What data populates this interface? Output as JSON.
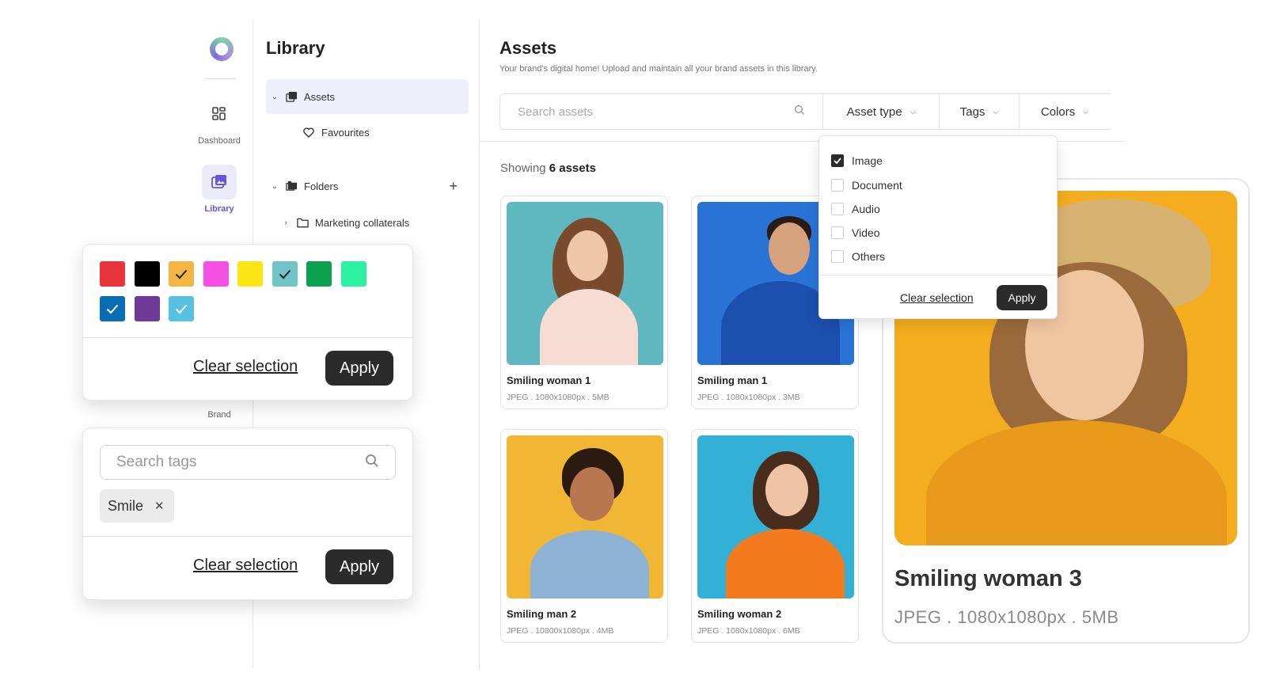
{
  "rail": {
    "items": [
      {
        "label": "Dashboard",
        "icon": "grid-icon"
      },
      {
        "label": "Library",
        "icon": "image-stack-icon",
        "active": true
      },
      {
        "label": "Brand",
        "icon": "brand-icon"
      }
    ]
  },
  "library": {
    "title": "Library",
    "tree": {
      "assets": "Assets",
      "favourites": "Favourites",
      "folders": "Folders",
      "marketing": "Marketing collaterals"
    }
  },
  "assets": {
    "title": "Assets",
    "subtitle": "Your brand's digital home! Upload and maintain all your brand assets in this library.",
    "search_placeholder": "Search assets",
    "filters": {
      "asset_type": "Asset type",
      "tags": "Tags",
      "colors": "Colors"
    },
    "showing_prefix": "Showing",
    "showing_count": "6 assets",
    "cards": [
      {
        "name": "Smiling woman 1",
        "meta": "JPEG . 1080x1080px . 5MB",
        "bg": "#5fb7bf"
      },
      {
        "name": "Smiling man 1",
        "meta": "JPEG . 1080x1080px . 3MB",
        "bg": "#2a73d6"
      },
      {
        "name": "Smiling man 2",
        "meta": "JPEG . 10800x1080px . 4MB",
        "bg": "#f1b633"
      },
      {
        "name": "Smiling woman 2",
        "meta": "JPEG . 1080x1080px . 6MB",
        "bg": "#33b0d6"
      }
    ]
  },
  "preview": {
    "name": "Smiling woman 3",
    "meta": "JPEG . 1080x1080px . 5MB"
  },
  "asset_type_dropdown": {
    "options": [
      {
        "label": "Image",
        "checked": true
      },
      {
        "label": "Document",
        "checked": false
      },
      {
        "label": "Audio",
        "checked": false
      },
      {
        "label": "Video",
        "checked": false
      },
      {
        "label": "Others",
        "checked": false
      }
    ],
    "clear_label": "Clear selection",
    "apply_label": "Apply"
  },
  "colors_panel": {
    "swatches": [
      {
        "color": "#e8343c",
        "checked": false
      },
      {
        "color": "#000000",
        "checked": false
      },
      {
        "color": "#f5b544",
        "checked": true
      },
      {
        "color": "#f54fe3",
        "checked": false
      },
      {
        "color": "#fbe514",
        "checked": false
      },
      {
        "color": "#72c3c7",
        "checked": true
      },
      {
        "color": "#0da04f",
        "checked": false
      },
      {
        "color": "#2cf1a0",
        "checked": false
      },
      {
        "color": "#0a6db4",
        "checked": true
      },
      {
        "color": "#6f3a98",
        "checked": false
      },
      {
        "color": "#56c1e2",
        "checked": true
      }
    ],
    "clear_label": "Clear selection",
    "apply_label": "Apply"
  },
  "tags_panel": {
    "search_placeholder": "Search tags",
    "tags": [
      "Smile"
    ],
    "clear_label": "Clear selection",
    "apply_label": "Apply"
  }
}
